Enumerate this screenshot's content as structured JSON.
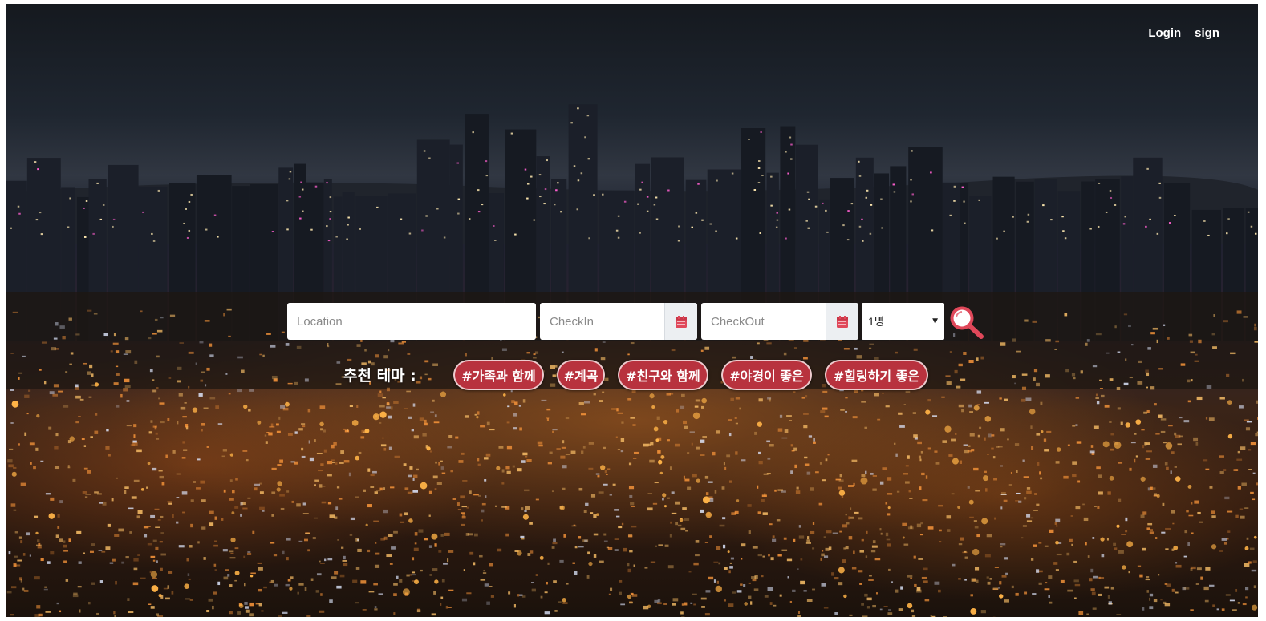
{
  "nav": {
    "login_label": "Login",
    "sign_label": "sign"
  },
  "search": {
    "location_placeholder": "Location",
    "checkin_placeholder": "CheckIn",
    "checkout_placeholder": "CheckOut",
    "guests_value": "1명"
  },
  "themes": {
    "label": "추천 테마 :",
    "tags": [
      "#가족과 함께",
      "#계곡",
      "#친구와 함께",
      "#야경이 좋은",
      "#힐링하기 좋은"
    ]
  },
  "colors": {
    "tag_background": "#b8323e",
    "calendar_icon": "#e0485a",
    "search_icon": "#e0485a"
  },
  "icons": {
    "calendar": "calendar-icon",
    "search": "magnifier-icon"
  }
}
